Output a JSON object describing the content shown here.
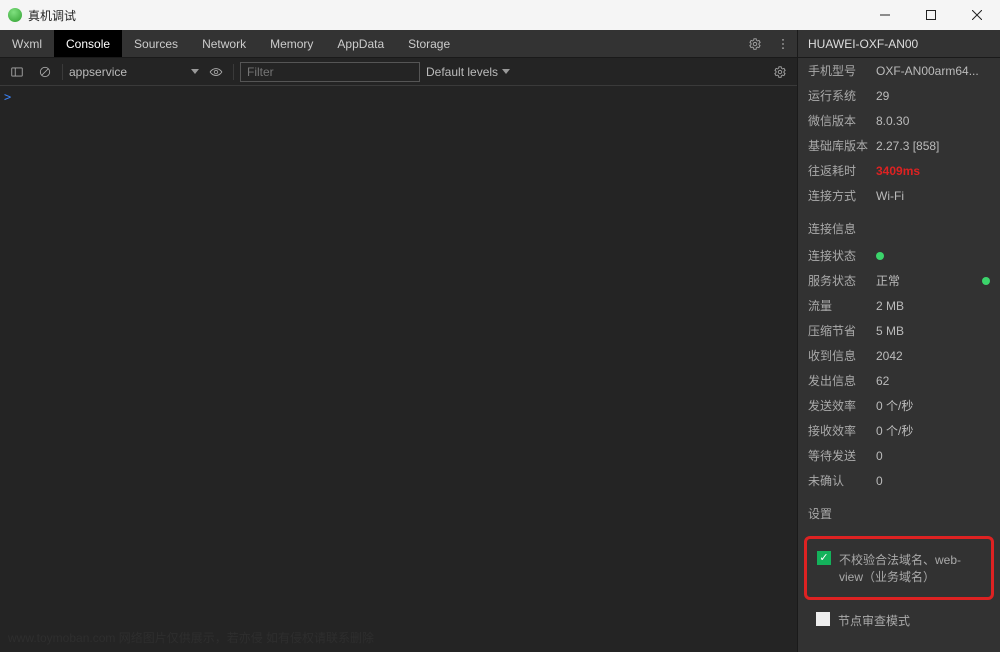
{
  "window": {
    "title": "真机调试"
  },
  "tabs": [
    {
      "label": "Wxml"
    },
    {
      "label": "Console"
    },
    {
      "label": "Sources"
    },
    {
      "label": "Network"
    },
    {
      "label": "Memory"
    },
    {
      "label": "AppData"
    },
    {
      "label": "Storage"
    }
  ],
  "active_tab_index": 1,
  "toolbar": {
    "context": "appservice",
    "filter_placeholder": "Filter",
    "filter_value": "",
    "levels_label": "Default levels"
  },
  "console": {
    "prompt": ">"
  },
  "right": {
    "device_title": "HUAWEI-OXF-AN00",
    "device_info": {
      "model_label": "手机型号",
      "model_value": "OXF-AN00arm64...",
      "os_label": "运行系统",
      "os_value": "29",
      "wechat_label": "微信版本",
      "wechat_value": "8.0.30",
      "base_label": "基础库版本",
      "base_value": "2.27.3 [858]",
      "rtt_label": "往返耗时",
      "rtt_value": "3409ms",
      "conn_label": "连接方式",
      "conn_value": "Wi-Fi"
    },
    "connection_title": "连接信息",
    "connection": {
      "conn_status_label": "连接状态",
      "srv_status_label": "服务状态",
      "srv_status_value": "正常",
      "traffic_label": "流量",
      "traffic_value": "2 MB",
      "compress_label": "压缩节省",
      "compress_value": "5 MB",
      "recv_label": "收到信息",
      "recv_value": "2042",
      "sent_label": "发出信息",
      "sent_value": "62",
      "send_rate_label": "发送效率",
      "send_rate_value": "0 个/秒",
      "recv_rate_label": "接收效率",
      "recv_rate_value": "0 个/秒",
      "pending_label": "等待发送",
      "pending_value": "0",
      "unconfirmed_label": "未确认",
      "unconfirmed_value": "0"
    },
    "settings_title": "设置",
    "settings": {
      "skip_domain_label": "不校验合法域名、web-view（业务域名）",
      "skip_domain_checked": true,
      "node_inspect_label": "节点审查模式",
      "node_inspect_checked": false
    }
  },
  "watermark": "www.toymoban.com 网络图片仅供展示，若亦侵   如有侵权请联系删除"
}
